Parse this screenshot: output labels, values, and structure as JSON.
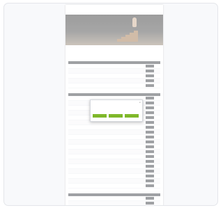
{
  "header": {
    "logo": "",
    "nav": [
      "",
      "",
      "",
      ""
    ]
  },
  "breadcrumb": "",
  "page_title": "",
  "sections": [
    {
      "label": "",
      "columns": [
        "",
        "",
        "",
        "",
        ""
      ],
      "row_count": 5
    },
    {
      "label": "",
      "columns": [
        "",
        "",
        "",
        "",
        ""
      ],
      "row_count": 19
    },
    {
      "label": "",
      "columns": [
        "",
        "",
        "",
        "",
        ""
      ],
      "row_count": 3
    }
  ],
  "row_button_label": "",
  "modal": {
    "title": "",
    "text": "",
    "buttons": [
      "",
      "",
      ""
    ]
  },
  "colors": {
    "accent": "#7fb82a",
    "section_label": "#5a7a16",
    "table_header": "#2b2f36"
  }
}
